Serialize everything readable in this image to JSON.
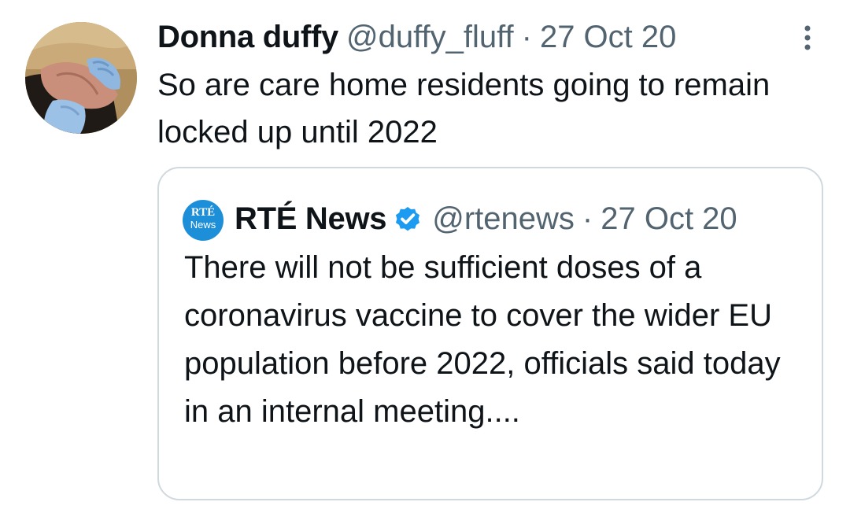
{
  "tweet": {
    "display_name": "Donna duffy",
    "handle": "@duffy_fluff",
    "separator": "·",
    "date": "27 Oct 20",
    "text": "So are care home residents going to remain locked up until 2022",
    "avatar_icon": "hands-holding-photo-avatar",
    "more_icon": "more-vertical-icon"
  },
  "quoted_tweet": {
    "avatar_logo_top": "RTÉ",
    "avatar_logo_bottom": "News",
    "display_name": "RTÉ News",
    "verified_icon": "verified-badge-icon",
    "handle": "@rtenews",
    "separator": "·",
    "date": "27 Oct 20",
    "text": "There will not be sufficient doses of a coronavirus vaccine to cover the wider EU population before 2022, officials said today in an internal meeting....",
    "avatar_color": "#1d8fd8"
  },
  "colors": {
    "text_primary": "#0f1419",
    "text_secondary": "#536471",
    "card_border": "#cfd9de",
    "verified_blue": "#1d9bf0"
  }
}
